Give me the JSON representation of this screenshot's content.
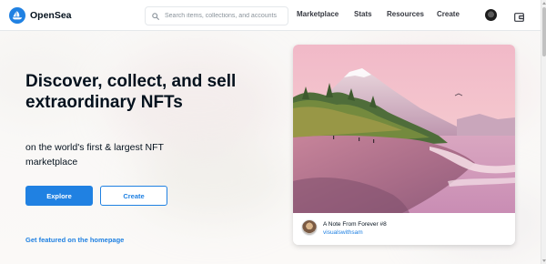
{
  "app": {
    "name": "OpenSea"
  },
  "header": {
    "search_placeholder": "Search items, collections, and accounts",
    "nav": {
      "marketplace": "Marketplace",
      "stats": "Stats",
      "resources": "Resources",
      "create": "Create"
    }
  },
  "hero": {
    "title": "Discover, collect, and sell extraordinary NFTs",
    "subtitle": "on the world's first & largest NFT marketplace",
    "explore_label": "Explore",
    "create_label": "Create",
    "featured_link": "Get featured on the homepage"
  },
  "featured": {
    "item_name": "A Note From Forever #8",
    "creator": "visualswithsam"
  },
  "icons": {
    "logo": "opensea-logo-icon",
    "search": "search-icon",
    "profile": "profile-icon",
    "wallet": "wallet-icon"
  },
  "colors": {
    "accent": "#2081e2",
    "text": "#04111d"
  }
}
